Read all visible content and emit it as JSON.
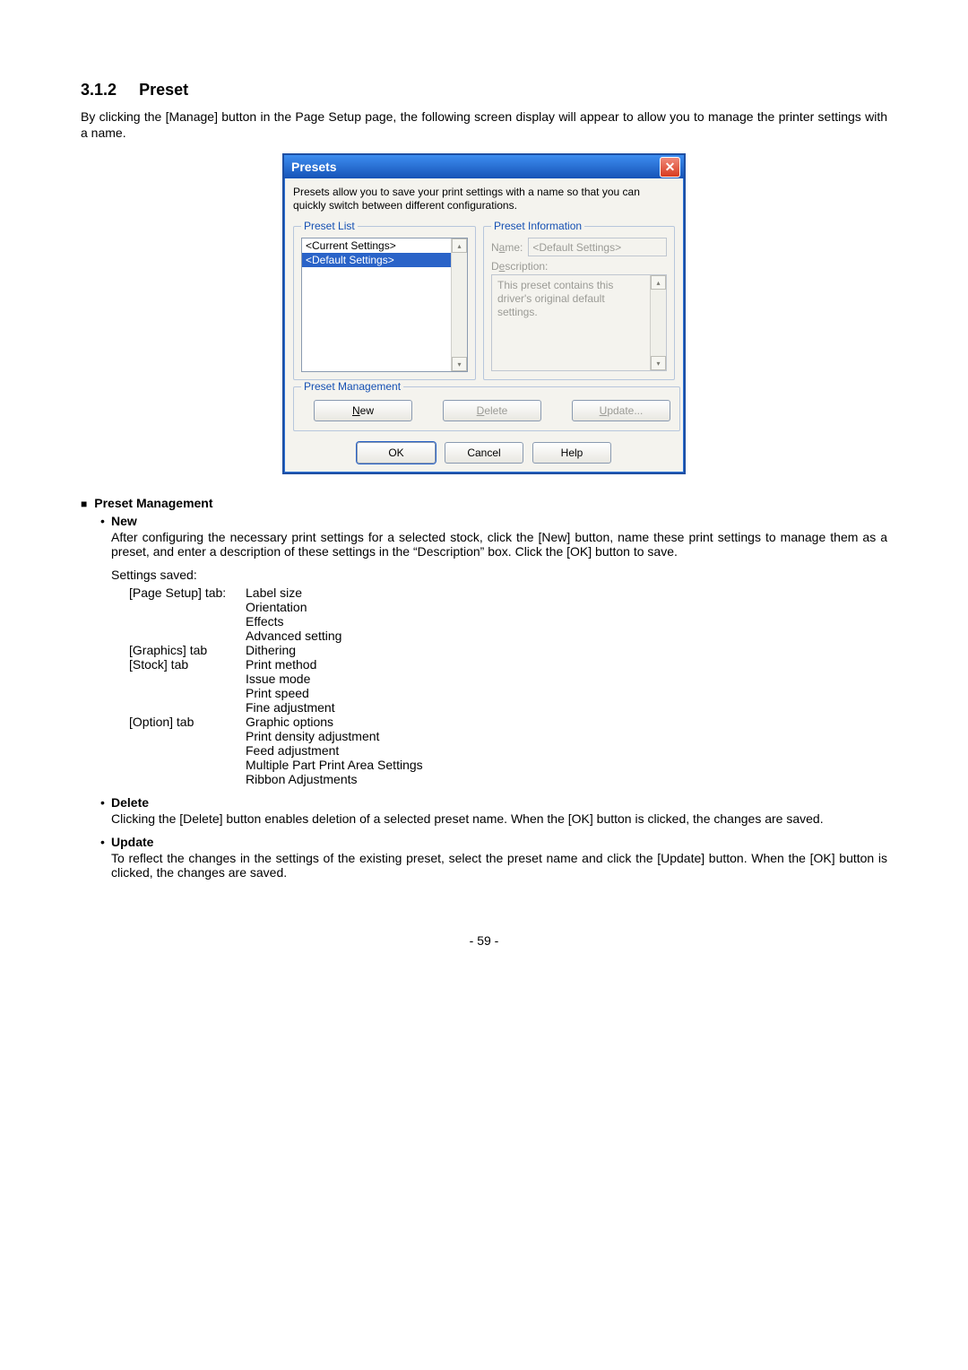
{
  "heading": {
    "number": "3.1.2",
    "title": "Preset"
  },
  "intro": "By clicking the [Manage] button in the Page Setup page, the following screen display will appear to allow you to manage the printer settings with a name.",
  "dialog": {
    "title": "Presets",
    "close_glyph": "✕",
    "subtitle": "Presets allow you to save your print settings with a name so that you can quickly switch between different configurations.",
    "preset_list_legend": "Preset List",
    "preset_items": [
      "<Current Settings>",
      "<Default Settings>"
    ],
    "preset_info_legend": "Preset Information",
    "name_label_pre": "N",
    "name_label_u": "a",
    "name_label_post": "me:",
    "name_value": "<Default Settings>",
    "desc_label_pre": "D",
    "desc_label_u": "e",
    "desc_label_post": "scription:",
    "desc_value": "This preset contains this driver's original default settings.",
    "mgmt_legend": "Preset Management",
    "new_u": "N",
    "new_post": "ew",
    "delete_u": "D",
    "delete_post": "elete",
    "update_u": "U",
    "update_post": "pdate...",
    "ok": "OK",
    "cancel": "Cancel",
    "help": "Help",
    "scroll_up": "▴",
    "scroll_down": "▾"
  },
  "pm": {
    "heading": "Preset Management",
    "new_title": "New",
    "new_body": "After configuring the necessary print settings for a selected stock, click the [New] button, name these print settings to manage them as a preset, and enter a description of these settings in the “Description” box.  Click the [OK] button to save.",
    "settings_saved": "Settings saved:",
    "rows": [
      {
        "tab": "[Page Setup] tab:",
        "items": [
          "Label size",
          "Orientation",
          "Effects",
          "Advanced setting"
        ]
      },
      {
        "tab": "[Graphics] tab",
        "items": [
          "Dithering"
        ]
      },
      {
        "tab": "[Stock] tab",
        "items": [
          "Print method",
          "Issue mode",
          "Print speed",
          "Fine adjustment"
        ]
      },
      {
        "tab": "[Option] tab",
        "items": [
          "Graphic options",
          "Print density adjustment",
          "Feed adjustment",
          "Multiple Part Print Area Settings",
          "Ribbon Adjustments"
        ]
      }
    ],
    "delete_title": "Delete",
    "delete_body": "Clicking the [Delete] button enables deletion of a selected preset name.   When the [OK] button is clicked, the changes are saved.",
    "update_title": "Update",
    "update_body": "To reflect the changes in the settings of the existing preset, select the preset name and click the [Update] button.   When the [OK] button is clicked, the changes are saved."
  },
  "page_number": "- 59 -"
}
